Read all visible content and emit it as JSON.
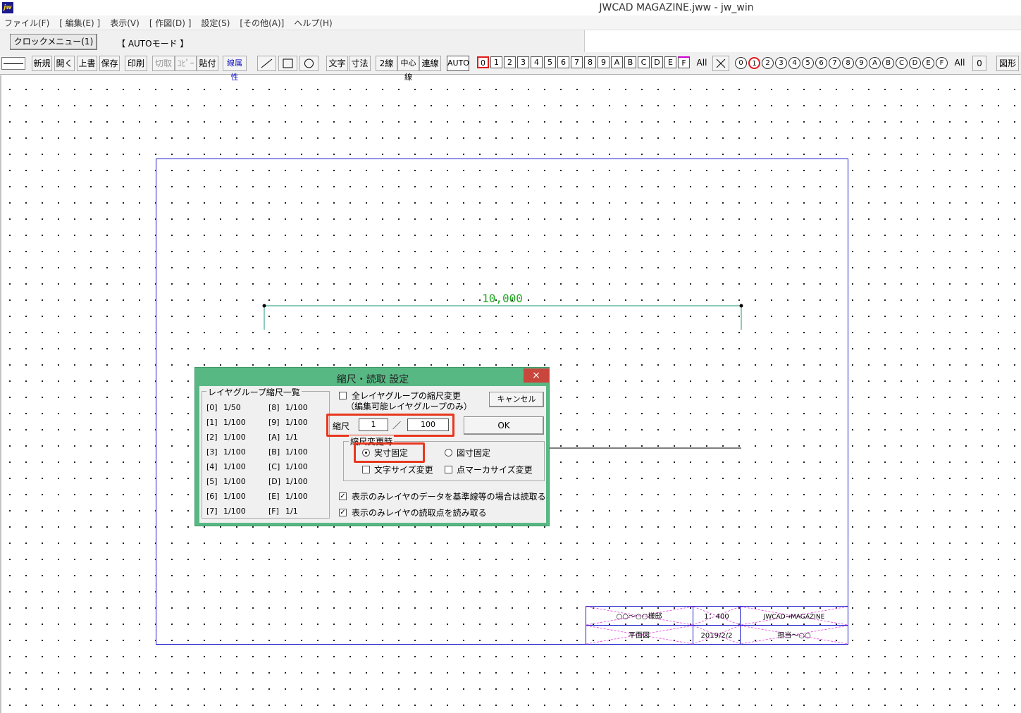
{
  "window": {
    "title": "JWCAD MAGAZINE.jww - jw_win",
    "app_icon_text": "jw"
  },
  "menu": [
    "ファイル(F)",
    "[ 編集(E) ]",
    "表示(V)",
    "[ 作図(D) ]",
    "設定(S)",
    "[その他(A)]",
    "ヘルプ(H)"
  ],
  "modebar": {
    "clock_menu": "クロックメニュー(1)",
    "mode": "【 AUTOモード 】"
  },
  "toolbar": {
    "new": "新規",
    "open": "開く",
    "overwrite": "上書",
    "save": "保存",
    "print": "印刷",
    "cut": "切取",
    "copy": "ｺﾋﾟｰ",
    "paste": "貼付",
    "line_attr": "線属性",
    "text": "文字",
    "dim": "寸法",
    "double_line": "2線",
    "center_line": "中心線",
    "continuous": "連線",
    "auto": "AUTO",
    "layer_groups": [
      "0",
      "1",
      "2",
      "3",
      "4",
      "5",
      "6",
      "7",
      "8",
      "9",
      "A",
      "B",
      "C",
      "D",
      "E",
      "F"
    ],
    "all_group": "All",
    "layers": [
      "0",
      "1",
      "2",
      "3",
      "4",
      "5",
      "6",
      "7",
      "8",
      "9",
      "A",
      "B",
      "C",
      "D",
      "E",
      "F"
    ],
    "all_layer": "All",
    "layer_zero_btn": "0",
    "shape": "図形"
  },
  "drawing": {
    "dimension_value": "10,000",
    "title_block": {
      "project": "○○～○○様邸",
      "scale": "1：400",
      "company": "JWCAD→MAGAZINE",
      "drawing_name": "平面図",
      "date": "2019/2/2",
      "person": "担当～○○"
    }
  },
  "dialog": {
    "title": "縮尺・読取 設定",
    "close": "×",
    "layer_group_list_label": "レイヤグループ縮尺一覧",
    "layer_groups_left": [
      {
        "id": "[0]",
        "scale": "1/50"
      },
      {
        "id": "[1]",
        "scale": "1/100"
      },
      {
        "id": "[2]",
        "scale": "1/100"
      },
      {
        "id": "[3]",
        "scale": "1/100"
      },
      {
        "id": "[4]",
        "scale": "1/100"
      },
      {
        "id": "[5]",
        "scale": "1/100"
      },
      {
        "id": "[6]",
        "scale": "1/100"
      },
      {
        "id": "[7]",
        "scale": "1/100"
      }
    ],
    "layer_groups_right": [
      {
        "id": "[8]",
        "scale": "1/100"
      },
      {
        "id": "[9]",
        "scale": "1/100"
      },
      {
        "id": "[A]",
        "scale": "1/1"
      },
      {
        "id": "[B]",
        "scale": "1/100"
      },
      {
        "id": "[C]",
        "scale": "1/100"
      },
      {
        "id": "[D]",
        "scale": "1/100"
      },
      {
        "id": "[E]",
        "scale": "1/100"
      },
      {
        "id": "[F]",
        "scale": "1/1"
      }
    ],
    "all_groups_change_label": "全レイヤグループの縮尺変更",
    "all_groups_change_sub": "（編集可能レイヤグループのみ）",
    "cancel": "キャンセル",
    "scale_label": "縮尺",
    "scale_numerator": "1",
    "scale_separator": "／",
    "scale_denominator": "100",
    "ok": "OK",
    "on_change_label": "縮尺変更時",
    "fixed_actual": "実寸固定",
    "fixed_drawing": "図寸固定",
    "text_size_change": "文字サイズ変更",
    "point_marker_size_change": "点マーカサイズ変更",
    "read_display_only_data": "表示のみレイヤのデータを基準線等の場合は読取る",
    "read_display_only_points": "表示のみレイヤの読取点を読み取る",
    "state": {
      "all_groups_change": false,
      "fixed_actual": true,
      "text_size_change": false,
      "point_marker_size_change": false,
      "read_display_only_data": true,
      "read_display_only_points": true
    }
  },
  "colors": {
    "dialog_frame": "#58b884",
    "highlight": "#e8371e",
    "frame_line": "#1a1acc",
    "dimension": "#1a9a78",
    "dimension_text": "#21a821",
    "close_button": "#c9463d"
  }
}
